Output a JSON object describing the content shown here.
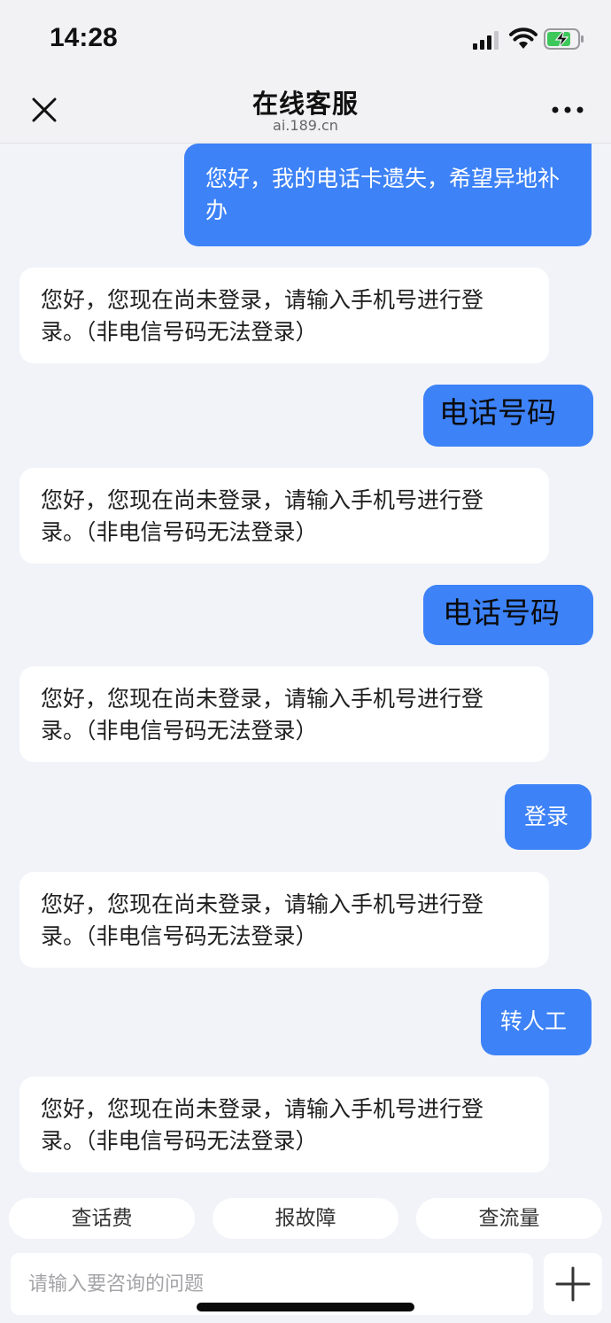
{
  "status_bar": {
    "time": "14:28"
  },
  "nav": {
    "title": "在线客服",
    "subtitle": "ai.189.cn"
  },
  "messages": [
    {
      "from": "user",
      "text": "您好，我的电话卡遗失，希望异地补办"
    },
    {
      "from": "bot",
      "text": "您好，您现在尚未登录，请输入手机号进行登录。（非电信号码无法登录）"
    },
    {
      "from": "user",
      "text": "电话号码"
    },
    {
      "from": "bot",
      "text": "您好，您现在尚未登录，请输入手机号进行登录。（非电信号码无法登录）"
    },
    {
      "from": "user",
      "text": "电话号码"
    },
    {
      "from": "bot",
      "text": "您好，您现在尚未登录，请输入手机号进行登录。（非电信号码无法登录）"
    },
    {
      "from": "user",
      "text": "登录"
    },
    {
      "from": "bot",
      "text": "您好，您现在尚未登录，请输入手机号进行登录。（非电信号码无法登录）"
    },
    {
      "from": "user",
      "text": "转人工"
    },
    {
      "from": "bot",
      "text": "您好，您现在尚未登录，请输入手机号进行登录。（非电信号码无法登录）"
    }
  ],
  "quick_replies": [
    "查话费",
    "报故障",
    "查流量"
  ],
  "input": {
    "placeholder": "请输入要咨询的问题",
    "value": ""
  },
  "colors": {
    "accent": "#3d82f7",
    "background": "#f1f3f8",
    "bot_bubble": "#ffffff"
  }
}
